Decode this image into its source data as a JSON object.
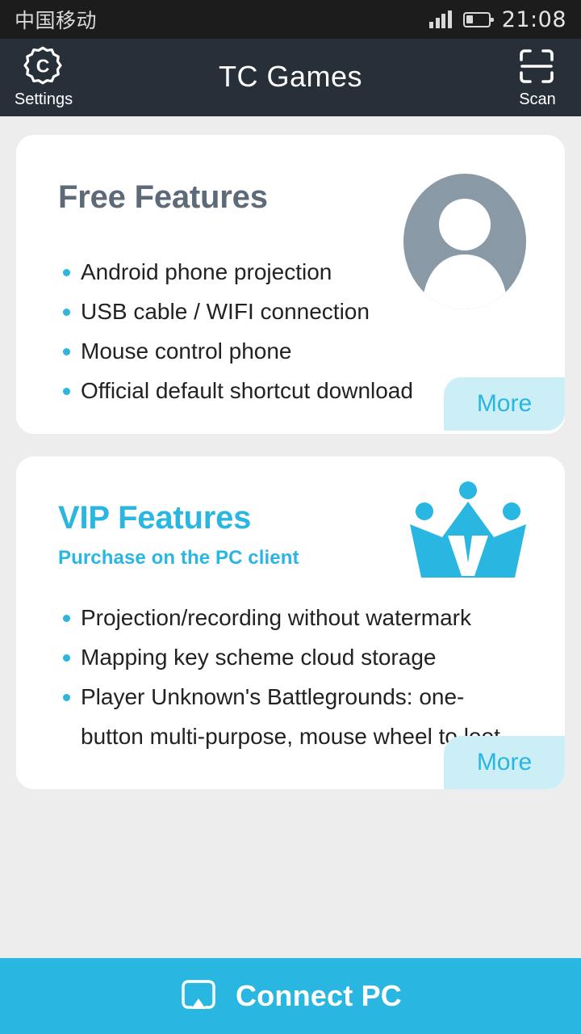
{
  "status_bar": {
    "carrier": "中国移动",
    "time": "21:08",
    "signal_icon": "signal-bars-icon",
    "battery_icon": "battery-low-icon"
  },
  "header": {
    "title": "TC Games",
    "left_action": {
      "label": "Settings",
      "icon": "settings-cog-icon"
    },
    "right_action": {
      "label": "Scan",
      "icon": "qr-scan-icon"
    }
  },
  "free_card": {
    "title": "Free Features",
    "avatar_icon": "user-avatar-icon",
    "features": [
      "Android phone projection",
      "USB cable / WIFI connection",
      "Mouse control phone",
      "Official default shortcut download"
    ],
    "more_label": "More"
  },
  "vip_card": {
    "title": "VIP Features",
    "subtitle": "Purchase on the PC client",
    "crown_icon": "vip-crown-icon",
    "features": [
      "Projection/recording without watermark",
      "Mapping key scheme cloud storage",
      "Player Unknown's Battlegrounds: one-button multi-purpose, mouse wheel to loot"
    ],
    "more_label": "More"
  },
  "bottom_bar": {
    "label": "Connect PC",
    "icon": "airplay-cast-icon"
  },
  "colors": {
    "status_bar_bg": "#1c1c1c",
    "header_bg": "#272f38",
    "page_bg": "#ededed",
    "card_bg": "#ffffff",
    "accent_cyan": "#29b6e0",
    "more_button_bg": "#cceef7",
    "free_title": "#5d6b78",
    "avatar_gray": "#8a99a6",
    "body_text": "#222222"
  }
}
